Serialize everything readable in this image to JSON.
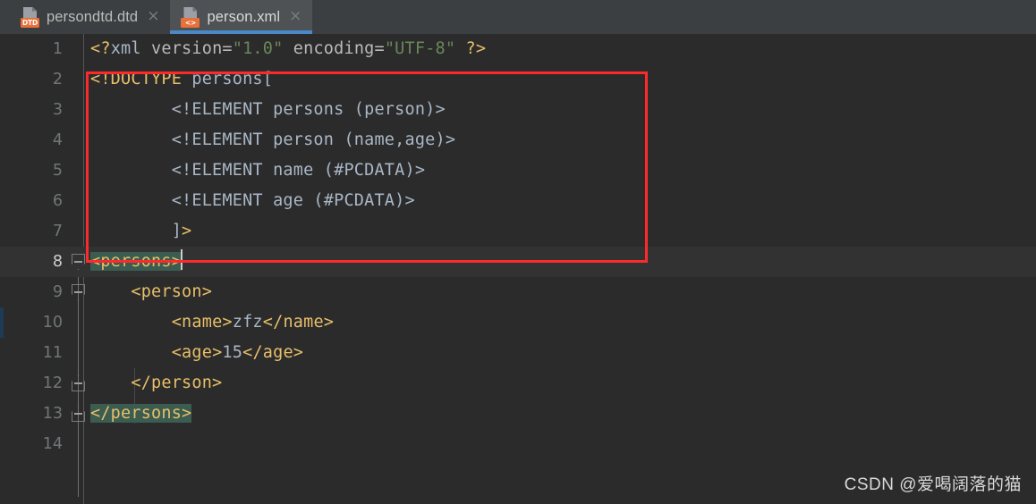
{
  "window": {
    "background": "#2b2b2b",
    "accent": "#4a88c7"
  },
  "tabbar": {
    "tabs": [
      {
        "label": "persondtd.dtd",
        "icon": "dtd-file-icon",
        "badge": "DTD",
        "active": false,
        "close_glyph": "×"
      },
      {
        "label": "person.xml",
        "icon": "xml-file-icon",
        "badge": "<>",
        "active": true,
        "close_glyph": "×"
      }
    ]
  },
  "editor": {
    "language": "xml",
    "filename": "person.xml",
    "current_line": 8,
    "total_lines": 14,
    "line_numbers": [
      "1",
      "2",
      "3",
      "4",
      "5",
      "6",
      "7",
      "8",
      "9",
      "10",
      "11",
      "12",
      "13",
      "14"
    ],
    "lines": [
      {
        "n": "1",
        "text": "<?xml version=\"1.0\" encoding=\"UTF-8\" ?>"
      },
      {
        "n": "2",
        "text": "<!DOCTYPE persons["
      },
      {
        "n": "3",
        "text": "        <!ELEMENT persons (person)>"
      },
      {
        "n": "4",
        "text": "        <!ELEMENT person (name,age)>"
      },
      {
        "n": "5",
        "text": "        <!ELEMENT name (#PCDATA)>"
      },
      {
        "n": "6",
        "text": "        <!ELEMENT age (#PCDATA)>"
      },
      {
        "n": "7",
        "text": "        ]>"
      },
      {
        "n": "8",
        "text": "<persons>"
      },
      {
        "n": "9",
        "text": "    <person>"
      },
      {
        "n": "10",
        "text": "        <name>zfz</name>"
      },
      {
        "n": "11",
        "text": "        <age>15</age>"
      },
      {
        "n": "12",
        "text": "    </person>"
      },
      {
        "n": "13",
        "text": "</persons>"
      },
      {
        "n": "14",
        "text": ""
      }
    ],
    "tokens": {
      "l1_open": "<?",
      "l1_name": "xml",
      "l1_attr1": " version=",
      "l1_val1": "\"1.0\"",
      "l1_attr2": " encoding=",
      "l1_val2": "\"UTF-8\"",
      "l1_close": " ?>",
      "l2_doctype": "<!DOCTYPE",
      "l2_rest": " persons[",
      "l3": "        <!ELEMENT persons (person)>",
      "l4": "        <!ELEMENT person (name,age)>",
      "l5": "        <!ELEMENT name (#PCDATA)>",
      "l6": "        <!ELEMENT age (#PCDATA)>",
      "l7_bracket": "        ]",
      "l7_gt": ">",
      "l8_tag": "<persons>",
      "l9_tag": "    <person>",
      "l10_indent": "        ",
      "l10_open": "<name>",
      "l10_text": "zfz",
      "l10_close": "</name>",
      "l11_indent": "        ",
      "l11_open": "<age>",
      "l11_text": "15",
      "l11_close": "</age>",
      "l12_tag": "    </person>",
      "l13_tag": "</persons>"
    },
    "colors": {
      "punctuation": "#e8bf6a",
      "tag": "#e8bf6a",
      "plain": "#a9b7c6",
      "string": "#6a8759",
      "attribute": "#bababa",
      "tag_pair_highlight": "#3b5c50",
      "current_line_bg": "#323232",
      "gutter_text": "#707677"
    }
  },
  "annotation": {
    "type": "red-rectangle",
    "color": "#fc2b2b",
    "covers_lines": "2-7"
  },
  "watermark": {
    "text": "CSDN @爱喝阔落的猫"
  }
}
